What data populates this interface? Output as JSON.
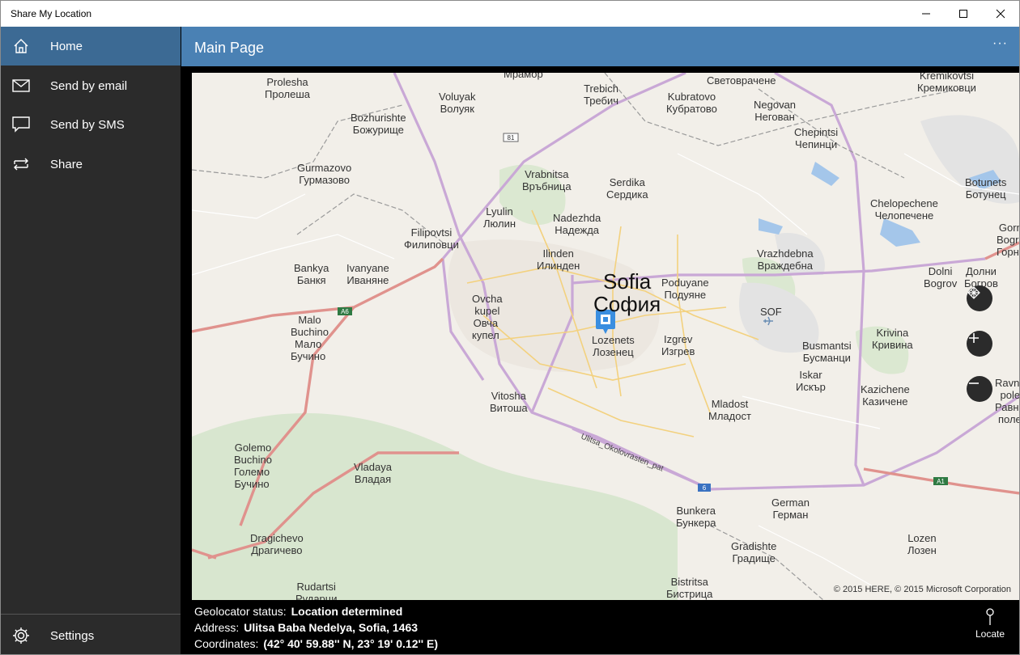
{
  "window": {
    "title": "Share My Location"
  },
  "sidebar": {
    "items": [
      {
        "label": "Home",
        "icon": "home-icon"
      },
      {
        "label": "Send by email",
        "icon": "mail-icon"
      },
      {
        "label": "Send by SMS",
        "icon": "message-icon"
      },
      {
        "label": "Share",
        "icon": "share-icon"
      }
    ],
    "settings": {
      "label": "Settings",
      "icon": "gear-icon"
    }
  },
  "header": {
    "title": "Main Page",
    "more": "···"
  },
  "map": {
    "copyright": "© 2015 HERE, © 2015 Microsoft Corporation",
    "places": [
      {
        "id": "prolesha",
        "l1": "Prolesha",
        "l2": "Пролеша"
      },
      {
        "id": "voluyak",
        "l1": "Voluyak",
        "l2": "Волуяк"
      },
      {
        "id": "mramor",
        "l1": "Мрамор",
        "l2": ""
      },
      {
        "id": "trebich",
        "l1": "Trebich",
        "l2": "Требич"
      },
      {
        "id": "kubratovo",
        "l1": "Kubratovo",
        "l2": "Кубратово"
      },
      {
        "id": "svetovrachene",
        "l1": "Световрачене",
        "l2": ""
      },
      {
        "id": "kremikovtsi",
        "l1": "Kremikovtsi",
        "l2": "Кремиковци"
      },
      {
        "id": "bozhurishte",
        "l1": "Bozhurishte",
        "l2": "Божурище"
      },
      {
        "id": "negovan",
        "l1": "Negovan",
        "l2": "Негован"
      },
      {
        "id": "chepintsi",
        "l1": "Chepintsi",
        "l2": "Чепинци"
      },
      {
        "id": "gurmazovo",
        "l1": "Gurmazovo",
        "l2": "Гурмазово"
      },
      {
        "id": "vrabnitsa",
        "l1": "Vrabnitsa",
        "l2": "Връбница"
      },
      {
        "id": "serdika",
        "l1": "Serdika",
        "l2": "Сердика"
      },
      {
        "id": "botunets",
        "l1": "Botunets",
        "l2": "Ботунец"
      },
      {
        "id": "lyulin",
        "l1": "Lyulin",
        "l2": "Люлин"
      },
      {
        "id": "nadezhda",
        "l1": "Nadezhda",
        "l2": "Надежда"
      },
      {
        "id": "chelopechene",
        "l1": "Chelopechene",
        "l2": "Челопечене"
      },
      {
        "id": "filipovtsi",
        "l1": "Filipovtsi",
        "l2": "Филиповци"
      },
      {
        "id": "gorni",
        "l1": "Gorn",
        "l2": "Bogro"
      },
      {
        "id": "ilinden",
        "l1": "Ilinden",
        "l2": "Илинден"
      },
      {
        "id": "vrazhdebna",
        "l1": "Vrazhdebna",
        "l2": "Враждебна"
      },
      {
        "id": "gorni2",
        "l1": "Горн",
        "l2": ""
      },
      {
        "id": "bankya",
        "l1": "Bankya",
        "l2": "Банкя"
      },
      {
        "id": "ivanyane",
        "l1": "Ivanyane",
        "l2": "Иваняне"
      },
      {
        "id": "poduyane",
        "l1": "Poduyane",
        "l2": "Подуяне"
      },
      {
        "id": "dolni",
        "l1": "Dolni",
        "l2": "Bogrov"
      },
      {
        "id": "dolni2",
        "l1": "Долни",
        "l2": "Богров"
      },
      {
        "id": "ovcha",
        "l1": "Ovcha",
        "l2": "kupel"
      },
      {
        "id": "ovcha2",
        "l1": "Овча",
        "l2": "купел"
      },
      {
        "id": "sof",
        "l1": "SOF",
        "l2": ""
      },
      {
        "id": "malo",
        "l1": "Malo",
        "l2": "Buchino"
      },
      {
        "id": "malo2",
        "l1": "Мало",
        "l2": "Бучино"
      },
      {
        "id": "lozenets",
        "l1": "Lozenets",
        "l2": "Лозенец"
      },
      {
        "id": "izgrev",
        "l1": "Izgrev",
        "l2": "Изгрев"
      },
      {
        "id": "busmantsi",
        "l1": "Busmantsi",
        "l2": "Бусманци"
      },
      {
        "id": "krivina",
        "l1": "Krivina",
        "l2": "Кривина"
      },
      {
        "id": "iskar",
        "l1": "Iskar",
        "l2": "Искър"
      },
      {
        "id": "ravno",
        "l1": "Ravno",
        "l2": "pole"
      },
      {
        "id": "ravno2",
        "l1": "Равно",
        "l2": "поле"
      },
      {
        "id": "kazichene",
        "l1": "Kazichene",
        "l2": "Казичене"
      },
      {
        "id": "vitosha",
        "l1": "Vitosha",
        "l2": "Витоша"
      },
      {
        "id": "mladost",
        "l1": "Mladost",
        "l2": "Младост"
      },
      {
        "id": "golemo",
        "l1": "Golemo",
        "l2": "Buchino"
      },
      {
        "id": "golemo2",
        "l1": "Големо",
        "l2": "Бучино"
      },
      {
        "id": "vladaya",
        "l1": "Vladaya",
        "l2": "Владая"
      },
      {
        "id": "german",
        "l1": "German",
        "l2": "Герман"
      },
      {
        "id": "bunkera",
        "l1": "Bunkera",
        "l2": "Бункера"
      },
      {
        "id": "dragichevo",
        "l1": "Dragichevo",
        "l2": "Драгичево"
      },
      {
        "id": "gradishte",
        "l1": "Gradishte",
        "l2": "Градище"
      },
      {
        "id": "lozen",
        "l1": "Lozen",
        "l2": "Лозен"
      },
      {
        "id": "bistritsa",
        "l1": "Bistritsa",
        "l2": "Бистрица"
      },
      {
        "id": "rudartsi",
        "l1": "Rudartsi",
        "l2": "Рударци"
      }
    ],
    "city": {
      "l1": "Sofia",
      "l2": "София"
    },
    "road_label": "Ulitsa_Okolovrasten_pat",
    "road_shields": [
      "81",
      "A6",
      "6",
      "A1"
    ],
    "controls": {
      "view": "grid-globe-icon",
      "zoom_in": "plus-icon",
      "zoom_out": "minus-icon"
    }
  },
  "info": {
    "status_label": "Geolocator status:",
    "status_value": "Location determined",
    "address_label": "Address:",
    "address_value": "Ulitsa Baba Nedelya, Sofia, 1463",
    "coords_label": "Coordinates:",
    "coords_value": "(42° 40' 59.88'' N, 23° 19' 0.12'' E)",
    "locate_label": "Locate"
  }
}
